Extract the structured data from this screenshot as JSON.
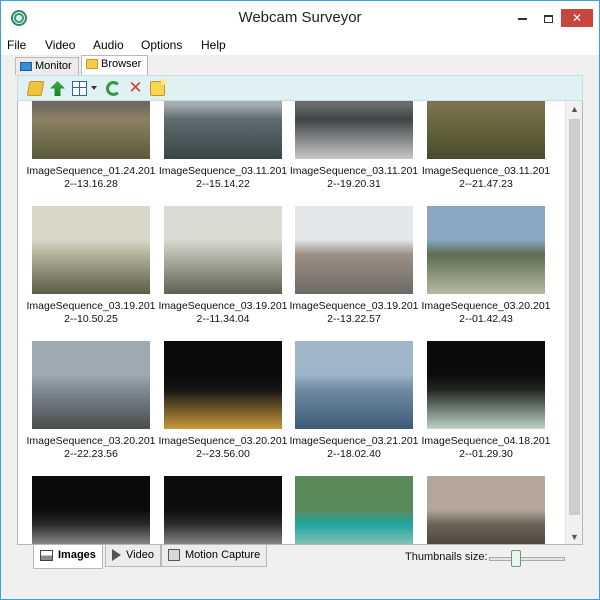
{
  "window": {
    "title": "Webcam Surveyor",
    "close_glyph": "✕"
  },
  "menu": [
    "File",
    "Video",
    "Audio",
    "Options",
    "Help"
  ],
  "top_tabs": [
    {
      "label": "Monitor",
      "icon": "monitor-icon",
      "active": false
    },
    {
      "label": "Browser",
      "icon": "folder-icon",
      "active": true
    }
  ],
  "toolbar": {
    "icons": [
      "open-folder-icon",
      "up-folder-icon",
      "view-mode-icon",
      "refresh-icon",
      "delete-icon",
      "new-folder-icon"
    ],
    "delete_glyph": "✕"
  },
  "thumbnails": [
    {
      "line1": "ImageSequence_01.24.201",
      "line2": "2--13.16.28",
      "scene": [
        "#6d6a5e",
        "#8c8064",
        "#5a5a3c"
      ]
    },
    {
      "line1": "ImageSequence_03.11.201",
      "line2": "2--15.14.22",
      "scene": [
        "#a6adb0",
        "#5f6b6f",
        "#3a4546"
      ]
    },
    {
      "line1": "ImageSequence_03.11.201",
      "line2": "2--19.20.31",
      "scene": [
        "#6b6b6b",
        "#3f4446",
        "#c8c8c8"
      ]
    },
    {
      "line1": "ImageSequence_03.11.201",
      "line2": "2--21.47.23",
      "scene": [
        "#7c7250",
        "#6a6a40",
        "#4b4a2c"
      ]
    },
    {
      "line1": "ImageSequence_03.19.201",
      "line2": "2--10.50.25",
      "scene": [
        "#d9d7c8",
        "#b4b29b",
        "#5c5b48"
      ]
    },
    {
      "line1": "ImageSequence_03.19.201",
      "line2": "2--11.34.04",
      "scene": [
        "#dad9d2",
        "#b9b8ac",
        "#5e5e52"
      ]
    },
    {
      "line1": "ImageSequence_03.19.201",
      "line2": "2--13.22.57",
      "scene": [
        "#e4e7ea",
        "#9c8f85",
        "#6e6a66"
      ]
    },
    {
      "line1": "ImageSequence_03.20.201",
      "line2": "2--01.42.43",
      "scene": [
        "#8aa7c4",
        "#5d6d4e",
        "#b7b9a6"
      ]
    },
    {
      "line1": "ImageSequence_03.20.201",
      "line2": "2--22.23.56",
      "scene": [
        "#9ea9b1",
        "#7f8b96",
        "#4a4c4a"
      ]
    },
    {
      "line1": "ImageSequence_03.20.201",
      "line2": "2--23.56.00",
      "scene": [
        "#0a0a0a",
        "#141414",
        "#c89a3a"
      ]
    },
    {
      "line1": "ImageSequence_03.21.201",
      "line2": "2--18.02.40",
      "scene": [
        "#9fb5c8",
        "#6f8aa2",
        "#3d5b78"
      ]
    },
    {
      "line1": "ImageSequence_04.18.201",
      "line2": "2--01.29.30",
      "scene": [
        "#0b0b0b",
        "#1f2620",
        "#bfd4c7"
      ]
    },
    {
      "line1": "",
      "line2": "",
      "scene": [
        "#0b0b0b",
        "#2a2a2a",
        "#dfe6e1"
      ]
    },
    {
      "line1": "",
      "line2": "",
      "scene": [
        "#0d0d0d",
        "#2d2d2d",
        "#d9e0dc"
      ]
    },
    {
      "line1": "",
      "line2": "",
      "scene": [
        "#5a8a5a",
        "#1fa6a0",
        "#e7dcc2"
      ]
    },
    {
      "line1": "",
      "line2": "",
      "scene": [
        "#b4a69a",
        "#6b6459",
        "#2f2b26"
      ]
    }
  ],
  "scroll": {
    "up": "▲",
    "down": "▼"
  },
  "bottom_tabs": [
    {
      "label": "Images",
      "icon": "image-icon",
      "active": true
    },
    {
      "label": "Video",
      "icon": "play-icon",
      "active": false
    },
    {
      "label": "Motion Capture",
      "icon": "motion-capture-icon",
      "active": false
    }
  ],
  "thumbnail_size": {
    "label": "Thumbnails size:",
    "value": 0.33
  }
}
